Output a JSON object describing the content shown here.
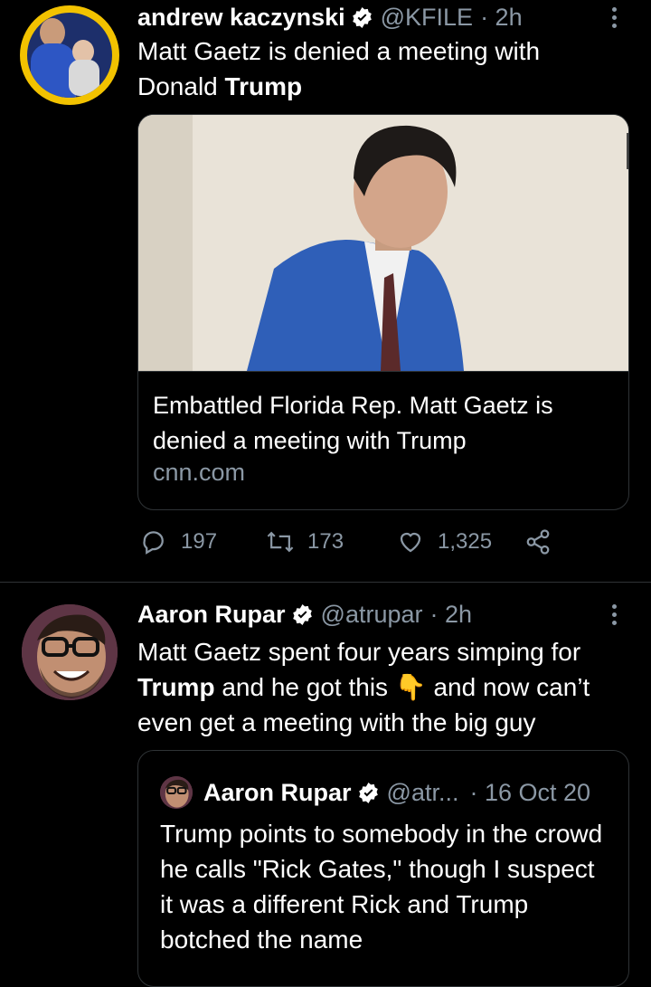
{
  "tweets": [
    {
      "author_name": "andrew kaczynski",
      "handle": "@KFILE",
      "time": "· 2h",
      "text_before": "Matt Gaetz is denied a meeting with Donald ",
      "text_bold": "Trump",
      "card": {
        "title": "Embattled Florida Rep. Matt Gaetz is denied a meeting with Trump",
        "domain": "cnn.com"
      },
      "stats": {
        "replies": "197",
        "retweets": "173",
        "likes": "1,325"
      }
    },
    {
      "author_name": "Aaron Rupar",
      "handle": "@atrupar",
      "time": "· 2h",
      "text_part1": "Matt Gaetz spent four years simping for ",
      "text_bold": "Trump",
      "text_part2": " and he got this ",
      "emoji": "👇",
      "text_part3": " and now can’t even get a meeting with the big guy",
      "quote": {
        "author_name": "Aaron Rupar",
        "handle": "@atr...",
        "time": "· 16 Oct 20",
        "text": "Trump points to somebody in the crowd he calls \"Rick Gates,\" though I suspect it was a different Rick and Trump botched the name"
      }
    }
  ],
  "colors": {
    "background": "#000000",
    "muted": "#8b98a5",
    "verified": "#ffffff",
    "divider": "#2f3336"
  },
  "icons": [
    "reply-icon",
    "retweet-icon",
    "like-icon",
    "share-icon",
    "verified-icon",
    "more-icon"
  ]
}
